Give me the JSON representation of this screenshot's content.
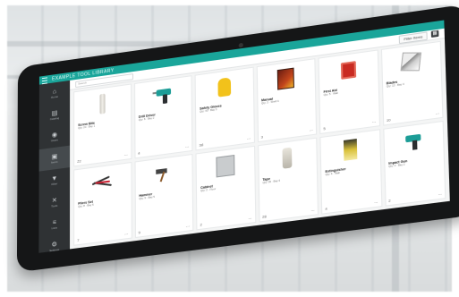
{
  "app": {
    "title": "EXAMPLE TOOL LIBRARY"
  },
  "toolbar": {
    "search_placeholder": "Search",
    "filter_label": "Filter Items",
    "grid_icon": "grid-icon"
  },
  "sidebar": {
    "items": [
      {
        "icon": "home-icon",
        "glyph": "⌂",
        "label": "Home"
      },
      {
        "icon": "catalog-icon",
        "glyph": "▤",
        "label": "Catalog"
      },
      {
        "icon": "user-icon",
        "glyph": "◉",
        "label": "Users"
      },
      {
        "icon": "box-icon",
        "glyph": "▣",
        "label": "Items"
      },
      {
        "icon": "filter-icon",
        "glyph": "▼",
        "label": "Filter"
      },
      {
        "icon": "tool-icon",
        "glyph": "✕",
        "label": "Tools"
      },
      {
        "icon": "list-icon",
        "glyph": "≡",
        "label": "Lists"
      },
      {
        "icon": "settings-icon",
        "glyph": "⚙",
        "label": "Settings"
      }
    ]
  },
  "cards": [
    {
      "name": "Screw Bits",
      "desc": "Qty: 24 · Bay 1",
      "thumb": "screw",
      "stock": "22",
      "action": "⋯"
    },
    {
      "name": "Drill Driver",
      "desc": "Qty: 6 · Bay 2",
      "thumb": "drill",
      "stock": "4",
      "action": "⋯"
    },
    {
      "name": "Safety Gloves",
      "desc": "Qty: 40 · Bay 3",
      "thumb": "glove",
      "stock": "38",
      "action": "⋯"
    },
    {
      "name": "Manual",
      "desc": "Qty: 3 · Shelf A",
      "thumb": "book",
      "stock": "3",
      "action": "⋯"
    },
    {
      "name": "First Aid",
      "desc": "Qty: 5 · Wall",
      "thumb": "box",
      "stock": "5",
      "action": "⋯"
    },
    {
      "name": "Blades",
      "desc": "Qty: 12 · Bay 4",
      "thumb": "blade",
      "stock": "10",
      "action": "⋯"
    },
    {
      "name": "Pliers Set",
      "desc": "Qty: 8 · Bay 5",
      "thumb": "pliers",
      "stock": "7",
      "action": "⋯"
    },
    {
      "name": "Hammer",
      "desc": "Qty: 9 · Bay 5",
      "thumb": "hammer",
      "stock": "9",
      "action": "⋯"
    },
    {
      "name": "Cabinet",
      "desc": "Qty: 2 · Floor",
      "thumb": "cabinet",
      "stock": "2",
      "action": "⋯"
    },
    {
      "name": "Tape",
      "desc": "Qty: 30 · Bay 6",
      "thumb": "tape",
      "stock": "28",
      "action": "⋯"
    },
    {
      "name": "Extinguisher",
      "desc": "Qty: 4 · Wall",
      "thumb": "fire",
      "stock": "4",
      "action": "⋯"
    },
    {
      "name": "Impact Gun",
      "desc": "Qty: 3 · Bay 2",
      "thumb": "gun",
      "stock": "2",
      "action": "⋯"
    }
  ]
}
